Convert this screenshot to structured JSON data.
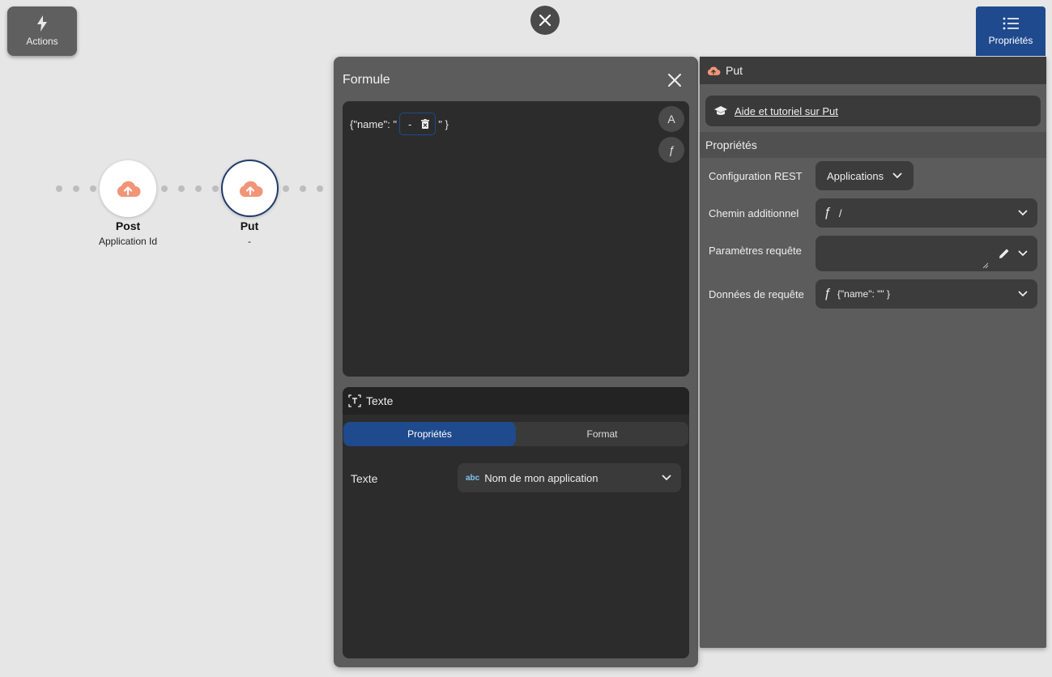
{
  "toolbar": {
    "actions_label": "Actions",
    "properties_toggle_label": "Propriétés"
  },
  "flow": {
    "nodes": [
      {
        "title": "Post",
        "subtitle": "Application Id",
        "icon": "cloud-upload-icon"
      },
      {
        "title": "Put",
        "subtitle": "-",
        "icon": "cloud-upload-icon",
        "selected": true
      }
    ]
  },
  "formule": {
    "title": "Formule",
    "code_prefix": "{\"name\": \"",
    "chip_value": "-",
    "code_suffix": "\" }",
    "btn_text_letter": "A",
    "btn_function_letter": "ƒ"
  },
  "texte": {
    "title": "Texte",
    "tabs": [
      {
        "label": "Propriétés",
        "active": true
      },
      {
        "label": "Format",
        "active": false
      }
    ],
    "field_label": "Texte",
    "field_type_badge": "abc",
    "field_value": "Nom de mon application"
  },
  "properties": {
    "title": "Put",
    "help_link": "Aide et tutoriel sur Put",
    "section_title": "Propriétés",
    "fields": [
      {
        "label": "Configuration REST",
        "value": "Applications"
      },
      {
        "label": "Chemin additionnel",
        "prefix": "ƒ",
        "value": "/"
      },
      {
        "label": "Paramètres requête",
        "value": ""
      },
      {
        "label": "Données de requête",
        "prefix": "ƒ",
        "value": "{\"name\": \"\" }"
      }
    ]
  },
  "colors": {
    "accent": "#1f4a8d",
    "node_icon": "#f29478",
    "panel": "#5c5c5c",
    "editor": "#2c2c2c"
  }
}
